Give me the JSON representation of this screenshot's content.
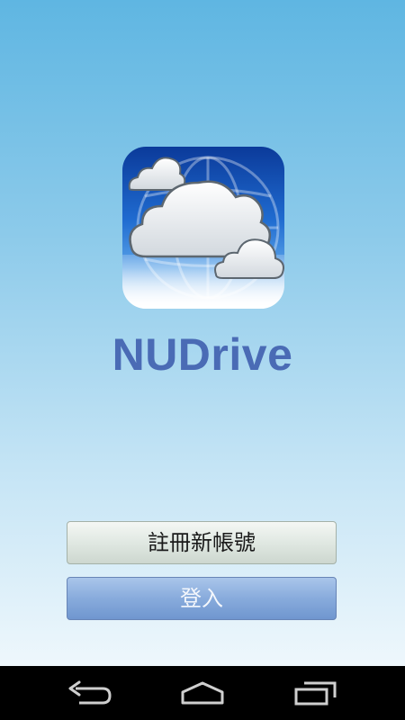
{
  "app": {
    "title": "NUDrive",
    "icon": "cloud-globe-app-icon"
  },
  "buttons": {
    "register_label": "註冊新帳號",
    "login_label": "登入"
  },
  "navbar": {
    "back_icon": "back-arrow-icon",
    "home_icon": "home-icon",
    "recent_icon": "recent-apps-icon"
  },
  "colors": {
    "title": "#4a6bb5",
    "background_top": "#5fb6e2",
    "background_bottom": "#eef7fc",
    "login_button": "#88abdc",
    "register_button": "#e0e8e2"
  }
}
